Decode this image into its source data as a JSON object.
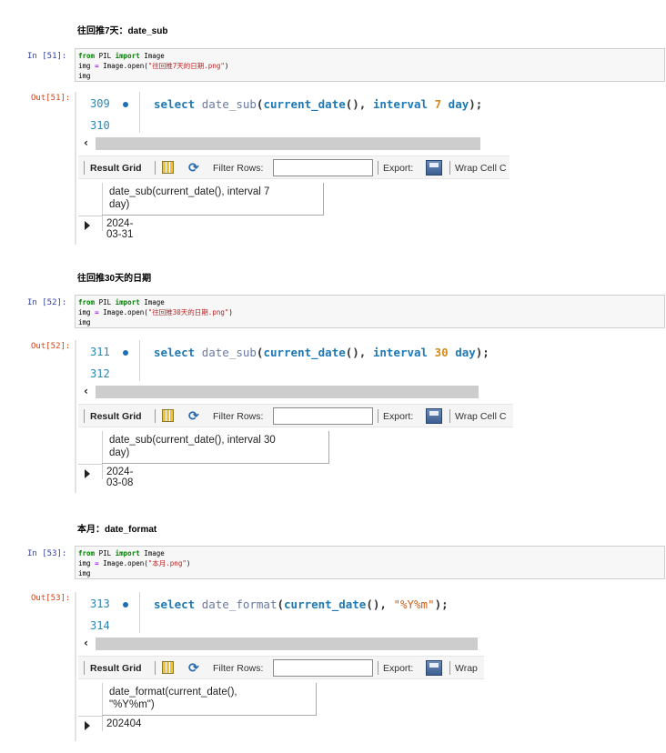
{
  "cells": [
    {
      "heading": "往回推7天：date_sub",
      "in_prompt": "In  [51]:",
      "out_prompt": "Out[51]:",
      "code": {
        "l1_kw1": "from",
        "l1_mod": " PIL ",
        "l1_kw2": "import",
        "l1_name": " Image",
        "l2_a": "img ",
        "l2_op": "=",
        "l2_b": " Image.open(",
        "l2_str": "\"往回推7天的日期.png\"",
        "l2_c": ")",
        "l3": "img"
      },
      "editor": {
        "line1": "309",
        "line2": "310",
        "sql_select": "select",
        "sql_fn": "date_sub",
        "sql_p1": "(",
        "sql_fn2": "current_date",
        "sql_p2": "(), ",
        "sql_kw2": "interval",
        "sql_num": "7",
        "sql_unit": "day",
        "sql_end": ");"
      },
      "toolbar": {
        "result_grid": "Result Grid",
        "filter_rows": "Filter Rows:",
        "export": "Export:",
        "wrap": "Wrap Cell C"
      },
      "grid": {
        "header_line1": "date_sub(current_date(), interval 7",
        "header_line2": "day)",
        "value": "2024-03-31"
      }
    },
    {
      "heading": "往回推30天的日期",
      "in_prompt": "In  [52]:",
      "out_prompt": "Out[52]:",
      "code": {
        "l1_kw1": "from",
        "l1_mod": " PIL ",
        "l1_kw2": "import",
        "l1_name": " Image",
        "l2_a": "img ",
        "l2_op": "=",
        "l2_b": " Image.open(",
        "l2_str": "\"往回推30天的日期.png\"",
        "l2_c": ")",
        "l3": "img"
      },
      "editor": {
        "line1": "311",
        "line2": "312",
        "sql_select": "select",
        "sql_fn": "date_sub",
        "sql_p1": "(",
        "sql_fn2": "current_date",
        "sql_p2": "(), ",
        "sql_kw2": "interval",
        "sql_num": "30",
        "sql_unit": "day",
        "sql_end": ");"
      },
      "toolbar": {
        "result_grid": "Result Grid",
        "filter_rows": "Filter Rows:",
        "export": "Export:",
        "wrap": "Wrap Cell C"
      },
      "grid": {
        "header_line1": "date_sub(current_date(), interval 30",
        "header_line2": "day)",
        "value": "2024-03-08"
      }
    },
    {
      "heading": "本月：date_format",
      "in_prompt": "In  [53]:",
      "out_prompt": "Out[53]:",
      "code": {
        "l1_kw1": "from",
        "l1_mod": " PIL ",
        "l1_kw2": "import",
        "l1_name": " Image",
        "l2_a": "img ",
        "l2_op": "=",
        "l2_b": " Image.open(",
        "l2_str": "\"本月.png\"",
        "l2_c": ")",
        "l3": "img"
      },
      "editor": {
        "line1": "313",
        "line2": "314",
        "sql_select": "select",
        "sql_fn": "date_format",
        "sql_p1": "(",
        "sql_fn2": "current_date",
        "sql_p2": "(), ",
        "sql_str": "\"%Y%m\"",
        "sql_end": ");"
      },
      "toolbar": {
        "result_grid": "Result Grid",
        "filter_rows": "Filter Rows:",
        "export": "Export:",
        "wrap": "Wrap"
      },
      "grid": {
        "header_line1": "date_format(current_date(),",
        "header_line2": "\"%Y%m\")",
        "value": "202404"
      }
    }
  ]
}
